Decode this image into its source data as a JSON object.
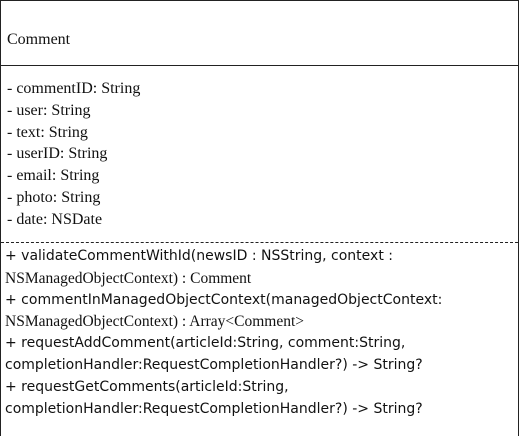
{
  "class_name": "Comment",
  "attributes": [
    "- commentID: String",
    "- user: String",
    "- text: String",
    "- userID: String",
    "- email: String",
    "- photo: String",
    "- date: NSDate"
  ],
  "operations": [
    "+ validateCommentWithId(newsID : NSString, context :",
    "NSManagedObjectContext) : Comment",
    "+ commentInManagedObjectContext(managedObjectContext:",
    "NSManagedObjectContext) : Array<Comment>",
    "+ requestAddComment(articleId:String, comment:String,",
    "completionHandler:RequestCompletionHandler?) -> String?",
    "+ requestGetComments(articleId:String,",
    "completionHandler:RequestCompletionHandler?) -> String?"
  ]
}
